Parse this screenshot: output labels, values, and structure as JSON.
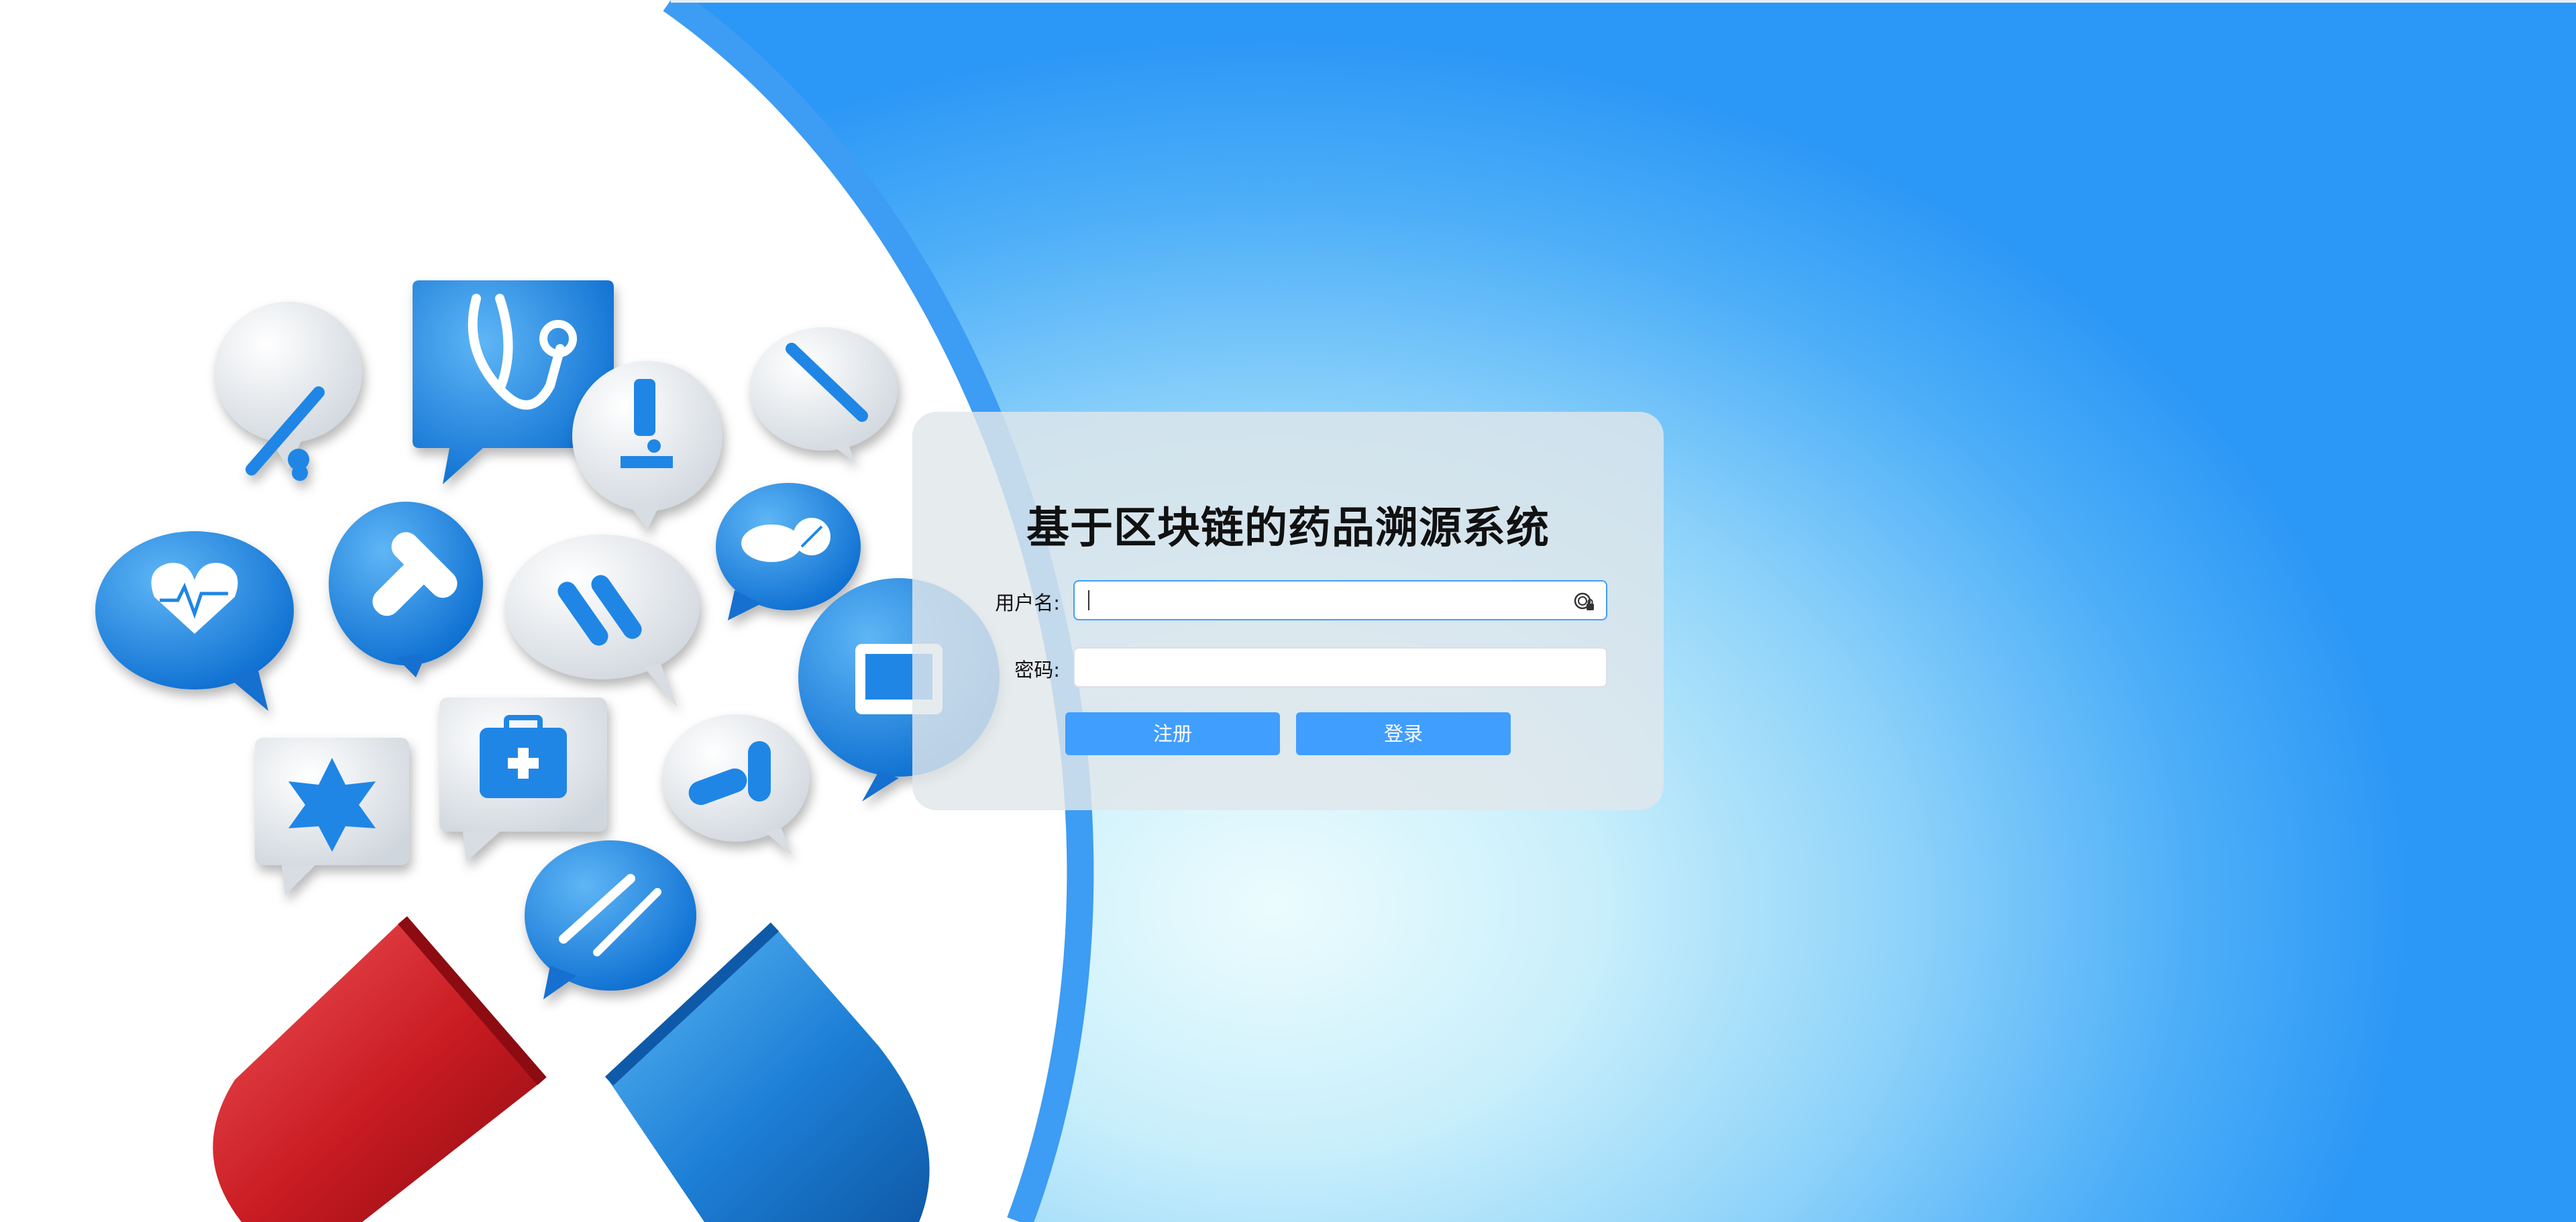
{
  "login": {
    "title": "基于区块链的药品溯源系统",
    "username_label": "用户名:",
    "username_value": "",
    "password_label": "密码:",
    "password_value": "",
    "register_button": "注册",
    "login_button": "登录"
  },
  "colors": {
    "accent": "#409eff",
    "arc_stroke": "#3d9cf3",
    "bubble_blue": "#1f86e6",
    "capsule_red": "#d8262b",
    "capsule_blue": "#1f80d8"
  },
  "icons": [
    "stethoscope-icon",
    "thermometer-icon",
    "microscope-icon",
    "syringe-icon",
    "heart-ecg-icon",
    "bandage-icon",
    "test-tubes-icon",
    "pills-icon",
    "monitor-icon",
    "medical-star-icon",
    "first-aid-kit-icon",
    "capsule-pill-icon",
    "syringe-pen-icon",
    "open-capsule-icon"
  ]
}
